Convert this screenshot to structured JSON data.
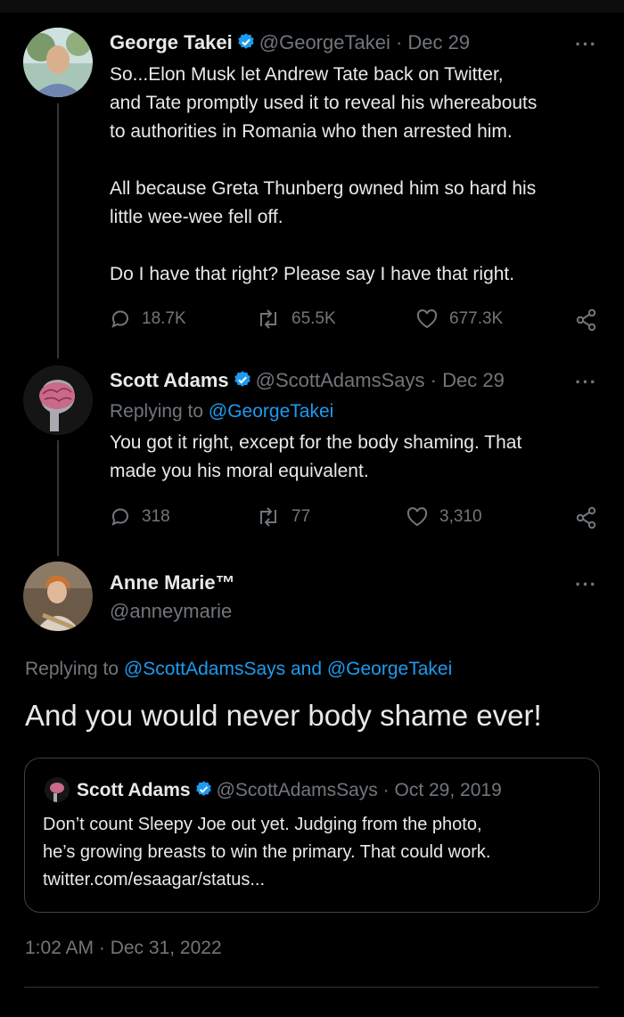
{
  "tweet1": {
    "display_name": "George Takei",
    "handle": "@GeorgeTakei",
    "separator": "·",
    "date": "Dec 29",
    "more": "···",
    "text": "So...Elon Musk let Andrew Tate back on Twitter,\nand Tate promptly used it to reveal his whereabouts\nto authorities in Romania who then arrested him.\n\nAll because Greta Thunberg owned him so hard his\nlittle wee-wee fell off.\n\nDo I have that right? Please say I have that right.",
    "replies": "18.7K",
    "retweets": "65.5K",
    "likes": "677.3K"
  },
  "tweet2": {
    "display_name": "Scott Adams",
    "handle": "@ScottAdamsSays",
    "separator": "·",
    "date": "Dec 29",
    "more": "···",
    "replying_prefix": "Replying to ",
    "replying_to": "@GeorgeTakei",
    "text": "You got it right, except for the body shaming. That\nmade you his moral equivalent.",
    "replies": "318",
    "retweets": "77",
    "likes": "3,310"
  },
  "main_tweet": {
    "display_name": "Anne Marie™",
    "handle": "@anneymarie",
    "more": "···",
    "replying_prefix": "Replying to ",
    "replying_to_1": "@ScottAdamsSays",
    "replying_and": " and ",
    "replying_to_2": "@GeorgeTakei",
    "text": "And you would never body shame ever!",
    "timestamp": "1:02 AM · Dec 31, 2022"
  },
  "quoted": {
    "display_name": "Scott Adams",
    "handle": "@ScottAdamsSays",
    "separator": "·",
    "date": "Oct 29, 2019",
    "text": "Don’t count Sleepy Joe out yet. Judging from the photo,\nhe’s growing breasts to win the primary. That could work.\ntwitter.com/esaagar/status..."
  },
  "colors": {
    "background": "#000000",
    "text": "#e7e9ea",
    "muted": "#71767b",
    "link": "#1d9bf0",
    "verified": "#1d9bf0"
  },
  "icons": [
    "reply-icon",
    "retweet-icon",
    "like-icon",
    "share-icon",
    "verified-badge-icon",
    "more-icon"
  ]
}
